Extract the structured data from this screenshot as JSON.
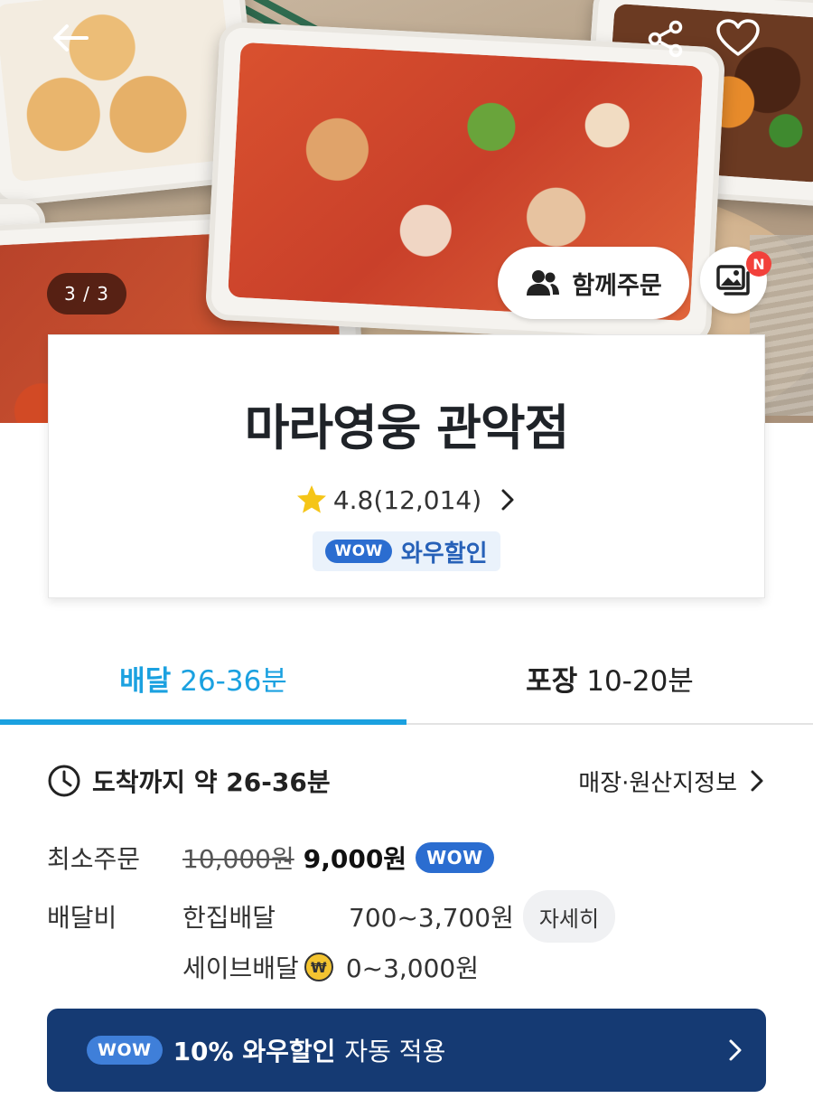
{
  "hero": {
    "counter": "3 / 3",
    "group_order_label": "함께주문",
    "photo_review_badge": "N"
  },
  "store": {
    "name": "마라영웅 관악점",
    "rating": "4.8",
    "review_count": "(12,014)",
    "wow_badge": "WOW",
    "wow_label": "와우할인"
  },
  "tabs": [
    {
      "bold": "배달",
      "time": "26-36분",
      "active": true
    },
    {
      "bold": "포장",
      "time": "10-20분",
      "active": false
    }
  ],
  "delivery": {
    "eta_text": "도착까지 약 26-36분",
    "store_info_link": "매장·원산지정보",
    "min_order_label": "최소주문",
    "min_order_original": "10,000원",
    "min_order_price": "9,000원",
    "min_order_badge": "WOW",
    "fee_label": "배달비",
    "fee_options": [
      {
        "type": "한집배달",
        "price": "700~3,700원"
      },
      {
        "type": "세이브배달",
        "price": "0~3,000원"
      }
    ],
    "detail_button": "자세히"
  },
  "wow_banner": {
    "badge": "WOW",
    "bold_text": "10% 와우할인",
    "text": "자동 적용"
  },
  "colors": {
    "accent": "#1ba1e0",
    "wow_blue": "#2b6dd0",
    "banner_bg": "#153a73",
    "badge_red": "#f2403a",
    "star": "#f5c518"
  }
}
